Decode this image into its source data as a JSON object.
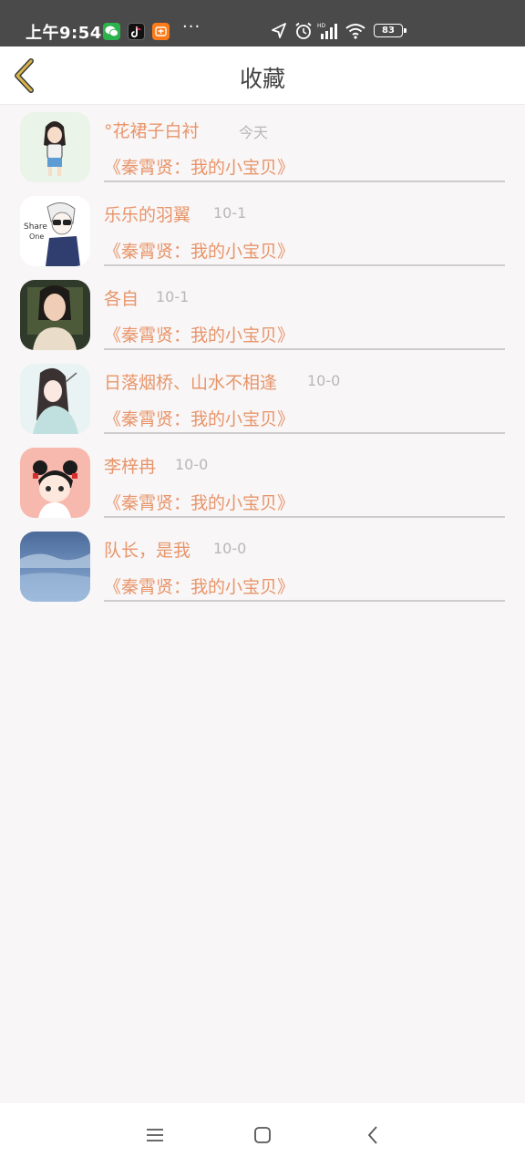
{
  "status_bar": {
    "time": "上午9:54",
    "battery": "83",
    "signal_label": "HD",
    "more": "···"
  },
  "header": {
    "title": "收藏"
  },
  "colors": {
    "accent": "#e8956a",
    "back_arrow": "#d8b64a",
    "date": "#b8b8b8"
  },
  "favorites": [
    {
      "name": "°花裙子白衬",
      "date": "今天",
      "book": "《秦霄贤：我的小宝贝》",
      "avatar": "girl-cartoon-avatar"
    },
    {
      "name": "乐乐的羽翼",
      "date": "10-1",
      "book": "《秦霄贤：我的小宝贝》",
      "avatar": "boy-sketch-avatar"
    },
    {
      "name": "各自",
      "date": "10-1",
      "book": "《秦霄贤：我的小宝贝》",
      "avatar": "photo-girl-avatar"
    },
    {
      "name": "日落烟桥、山水不相逢",
      "date": "10-0",
      "book": "《秦霄贤：我的小宝贝》",
      "avatar": "ancient-lady-avatar"
    },
    {
      "name": "李梓冉",
      "date": "10-0",
      "book": "《秦霄贤：我的小宝贝》",
      "avatar": "chibi-boy-avatar"
    },
    {
      "name": "队长，是我",
      "date": "10-0",
      "book": "《秦霄贤：我的小宝贝》",
      "avatar": "snow-landscape-avatar"
    }
  ]
}
